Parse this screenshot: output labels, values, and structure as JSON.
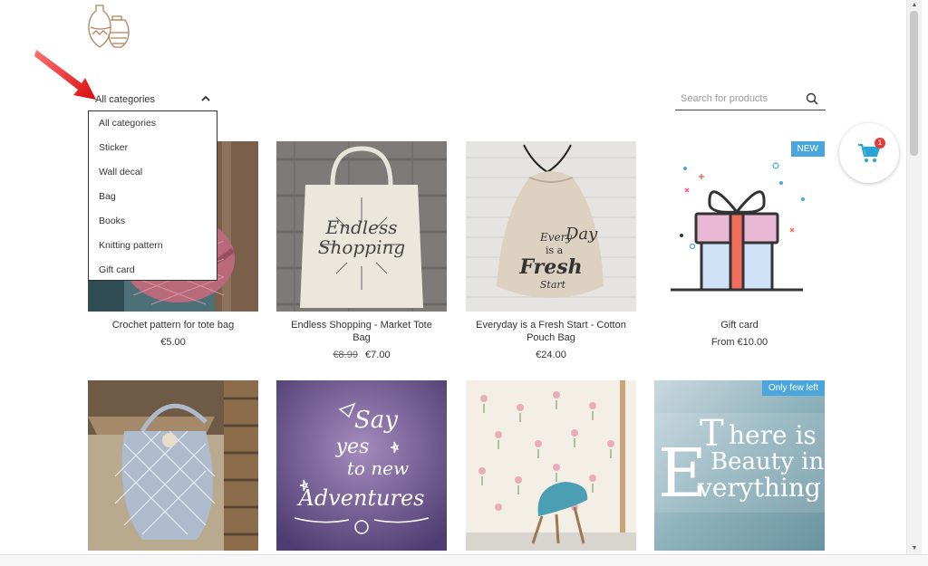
{
  "header": {
    "logo_icon": "pottery-vases-logo-icon"
  },
  "category_filter": {
    "selected": "All categories",
    "options": [
      "All categories",
      "Sticker",
      "Wall decal",
      "Bag",
      "Books",
      "Knitting pattern",
      "Gift card"
    ]
  },
  "search": {
    "placeholder": "Search for products"
  },
  "cart": {
    "count": "1",
    "accent": "#2aa3d6"
  },
  "products": [
    {
      "title": "Crochet pattern for tote bag",
      "price": "€5.00",
      "old_price": ""
    },
    {
      "title": "Endless Shopping - Market Tote Bag",
      "price": "€7.00",
      "old_price": "€8.99",
      "image_text": [
        "Endless",
        "Shopping"
      ]
    },
    {
      "title": "Everyday is a Fresh Start - Cotton Pouch Bag",
      "price": "€24.00",
      "old_price": "",
      "image_text": [
        "Every",
        "Day",
        "is a",
        "Fresh",
        "Start"
      ]
    },
    {
      "title": "Gift card",
      "price": "From €10.00",
      "old_price": "",
      "badge": "NEW"
    },
    {
      "title": "",
      "price": "",
      "old_price": ""
    },
    {
      "title": "",
      "price": "",
      "old_price": "",
      "image_text": [
        "Say",
        "yes",
        "to new",
        "Adventures"
      ]
    },
    {
      "title": "",
      "price": "",
      "old_price": ""
    },
    {
      "title": "",
      "price": "",
      "old_price": "",
      "badge": "Only few left",
      "image_text": [
        "here is",
        "Beauty in",
        "verything",
        "T",
        "E"
      ]
    }
  ],
  "colors": {
    "badge": "#4aa6dc",
    "arrow": "#e02020",
    "logo": "#b5825a"
  }
}
